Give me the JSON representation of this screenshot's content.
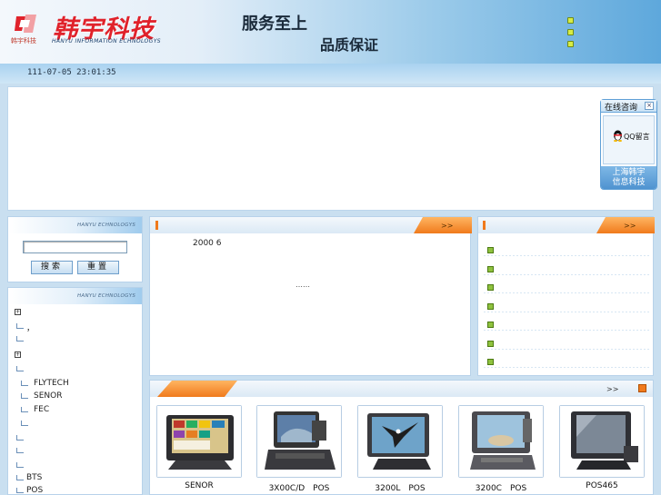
{
  "header": {
    "logo_small": "韩宇科技",
    "logo_cn": "韩宇科技",
    "logo_en": "HANYU INFORMATION ECHNOLOGYS",
    "slogan_line1": "服务至上",
    "slogan_line2": "品质保证",
    "icons": [
      "small-square-icon",
      "small-square-icon",
      "small-square-icon"
    ]
  },
  "datebar": {
    "datetime": "111-07-05 23:01:35"
  },
  "consult": {
    "title": "在线咨询",
    "close": "×",
    "qq_label": "QQ留言",
    "footer_line1": "上海韩宇",
    "footer_line2": "信息科技"
  },
  "search_panel": {
    "header_tag": "HANYU ECHNOLOGYS",
    "input_value": "",
    "search_button": "搜索",
    "reset_button": "重置"
  },
  "category_panel": {
    "header_tag": "HANYU ECHNOLOGYS",
    "items": [
      {
        "type": "plus",
        "label": ""
      },
      {
        "type": "branch",
        "label": "，"
      },
      {
        "type": "branch",
        "label": ""
      },
      {
        "type": "plus",
        "label": ""
      },
      {
        "type": "branch",
        "label": ""
      },
      {
        "type": "branch2",
        "label": "FLYTECH"
      },
      {
        "type": "branch2",
        "label": "SENOR"
      },
      {
        "type": "branch2",
        "label": "FEC"
      },
      {
        "type": "branch2",
        "label": ""
      },
      {
        "type": "branch",
        "label": ""
      },
      {
        "type": "branch",
        "label": ""
      },
      {
        "type": "branch",
        "label": ""
      },
      {
        "type": "branch",
        "label": "BTS"
      },
      {
        "type": "branch",
        "label": "POS"
      }
    ]
  },
  "about_panel": {
    "more": ">>",
    "text_line1": "2000 6",
    "ellipsis": "……"
  },
  "news_panel": {
    "more": ">>",
    "items": [
      "",
      "",
      "",
      "",
      "",
      "",
      ""
    ]
  },
  "products_panel": {
    "more": ">>",
    "items": [
      {
        "label": "SENOR"
      },
      {
        "label": "3X00C/D　POS"
      },
      {
        "label": "3200L　POS"
      },
      {
        "label": "3200C　POS"
      },
      {
        "label": "POS465"
      }
    ]
  }
}
